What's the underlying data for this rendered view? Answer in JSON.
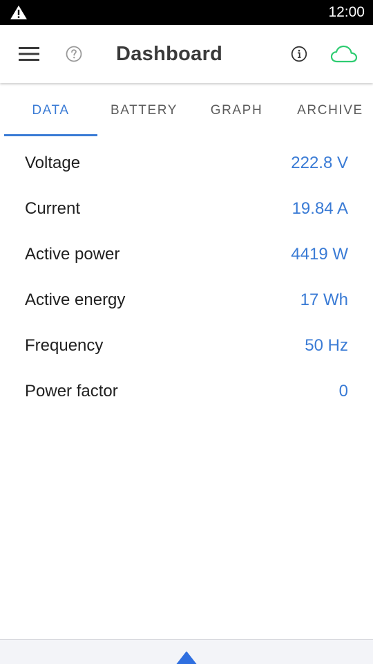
{
  "status_bar": {
    "time": "12:00",
    "warning_icon": "warning-icon"
  },
  "app_bar": {
    "title": "Dashboard",
    "menu_icon": "menu-icon",
    "help_icon": "help-icon",
    "info_icon": "info-icon",
    "cloud_icon": "cloud-icon",
    "cloud_color": "#2ecc71"
  },
  "tabs": [
    {
      "label": "DATA",
      "active": true
    },
    {
      "label": "BATTERY",
      "active": false
    },
    {
      "label": "GRAPH",
      "active": false
    },
    {
      "label": "ARCHIVE",
      "active": false
    }
  ],
  "readings": [
    {
      "label": "Voltage",
      "value": "222.8 V"
    },
    {
      "label": "Current",
      "value": "19.84 A"
    },
    {
      "label": "Active power",
      "value": "4419 W"
    },
    {
      "label": "Active energy",
      "value": "17 Wh"
    },
    {
      "label": "Frequency",
      "value": "50 Hz"
    },
    {
      "label": "Power factor",
      "value": "0"
    }
  ],
  "bottom_sheet": {
    "handle_icon": "expand-up-icon"
  },
  "colors": {
    "accent": "#3a7bd5",
    "status_bar": "#000000",
    "cloud": "#2ecc71"
  }
}
